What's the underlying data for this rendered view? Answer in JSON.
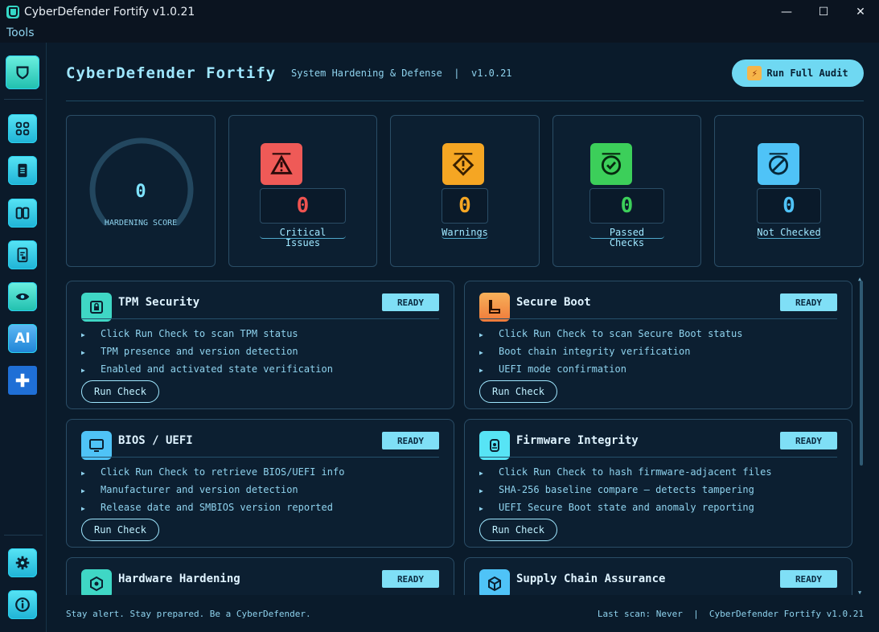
{
  "window": {
    "title": "CyberDefender Fortify v1.0.21",
    "controls": {
      "minimize": "—",
      "maximize": "☐",
      "close": "✕"
    }
  },
  "menubar": {
    "items": [
      "Tools"
    ]
  },
  "sidebar": {
    "logo_icon": "shield-icon",
    "items": [
      {
        "icon": "dashboard-grid-icon"
      },
      {
        "icon": "document-icon"
      },
      {
        "icon": "columns-icon"
      },
      {
        "icon": "checklist-icon"
      },
      {
        "icon": "eye-icon"
      },
      {
        "icon": "ai-icon",
        "text": "AI"
      },
      {
        "icon": "plus-icon"
      }
    ],
    "bottom": [
      {
        "icon": "gear-icon"
      },
      {
        "icon": "info-icon"
      }
    ]
  },
  "header": {
    "title": "CyberDefender Fortify",
    "subtitle": "System Hardening & Defense  |  v1.0.21",
    "audit_button": "Run Full Audit"
  },
  "stats": {
    "score": {
      "value": "0",
      "label": "HARDENING SCORE"
    },
    "critical": {
      "value": "0",
      "label": "Critical Issues",
      "color": "#ef5350"
    },
    "warnings": {
      "value": "0",
      "label": "Warnings",
      "color": "#f5a623"
    },
    "passed": {
      "value": "0",
      "label": "Passed Checks",
      "color": "#3ccf5a"
    },
    "not_checked": {
      "value": "0",
      "label": "Not Checked",
      "color": "#4fc3f7"
    }
  },
  "cards": [
    {
      "title": "TPM Security",
      "status": "READY",
      "icon": "chip-lock-icon",
      "bullets": [
        "Click Run Check to scan TPM status",
        "TPM presence and version detection",
        "Enabled and activated state verification"
      ],
      "button": "Run Check"
    },
    {
      "title": "Secure Boot",
      "status": "READY",
      "icon": "boot-icon",
      "bullets": [
        "Click Run Check to scan Secure Boot status",
        "Boot chain integrity verification",
        "UEFI mode confirmation"
      ],
      "button": "Run Check"
    },
    {
      "title": "BIOS / UEFI",
      "status": "READY",
      "icon": "monitor-icon",
      "bullets": [
        "Click Run Check to retrieve BIOS/UEFI info",
        "Manufacturer and version detection",
        "Release date and SMBIOS version reported"
      ],
      "button": "Run Check"
    },
    {
      "title": "Firmware Integrity",
      "status": "READY",
      "icon": "firmware-icon",
      "bullets": [
        "Click Run Check to hash firmware-adjacent files",
        "SHA-256 baseline compare — detects tampering",
        "UEFI Secure Boot state and anomaly reporting"
      ],
      "button": "Run Check"
    },
    {
      "title": "Hardware Hardening",
      "status": "READY",
      "icon": "hexagon-chip-icon",
      "bullets": [],
      "button": ""
    },
    {
      "title": "Supply Chain Assurance",
      "status": "READY",
      "icon": "package-icon",
      "bullets": [],
      "button": ""
    }
  ],
  "footer": {
    "left": "Stay alert. Stay prepared. Be a CyberDefender.",
    "right": "Last scan: Never  |  CyberDefender Fortify v1.0.21"
  }
}
